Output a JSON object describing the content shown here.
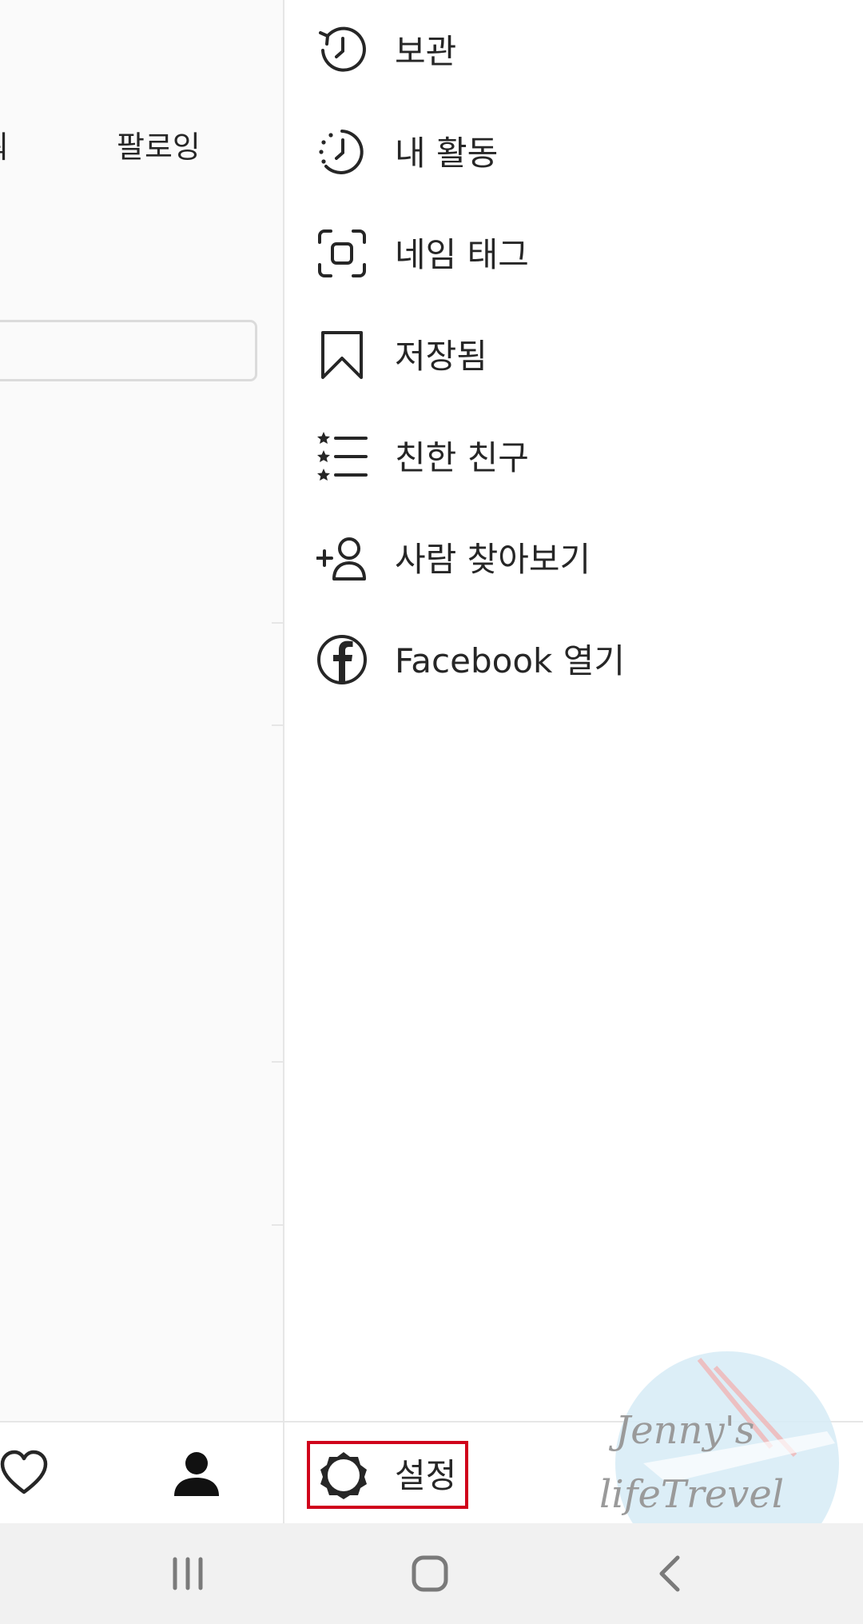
{
  "background": {
    "stat_partial": "워",
    "stat_following": "팔로잉"
  },
  "drawer": {
    "items": [
      {
        "label": "보관",
        "icon": "archive-history-icon"
      },
      {
        "label": "내 활동",
        "icon": "activity-clock-icon"
      },
      {
        "label": "네임 태그",
        "icon": "nametag-scan-icon"
      },
      {
        "label": "저장됨",
        "icon": "bookmark-icon"
      },
      {
        "label": "친한 친구",
        "icon": "close-friends-list-icon"
      },
      {
        "label": "사람 찾아보기",
        "icon": "add-person-icon"
      },
      {
        "label": "Facebook 열기",
        "icon": "facebook-icon"
      }
    ],
    "settings_label": "설정"
  },
  "colors": {
    "highlight": "#d0021b",
    "text": "#262626",
    "divider": "#e6e6e6"
  },
  "watermark": {
    "line1": "Jenny's",
    "line2": "lifeTrevel"
  }
}
